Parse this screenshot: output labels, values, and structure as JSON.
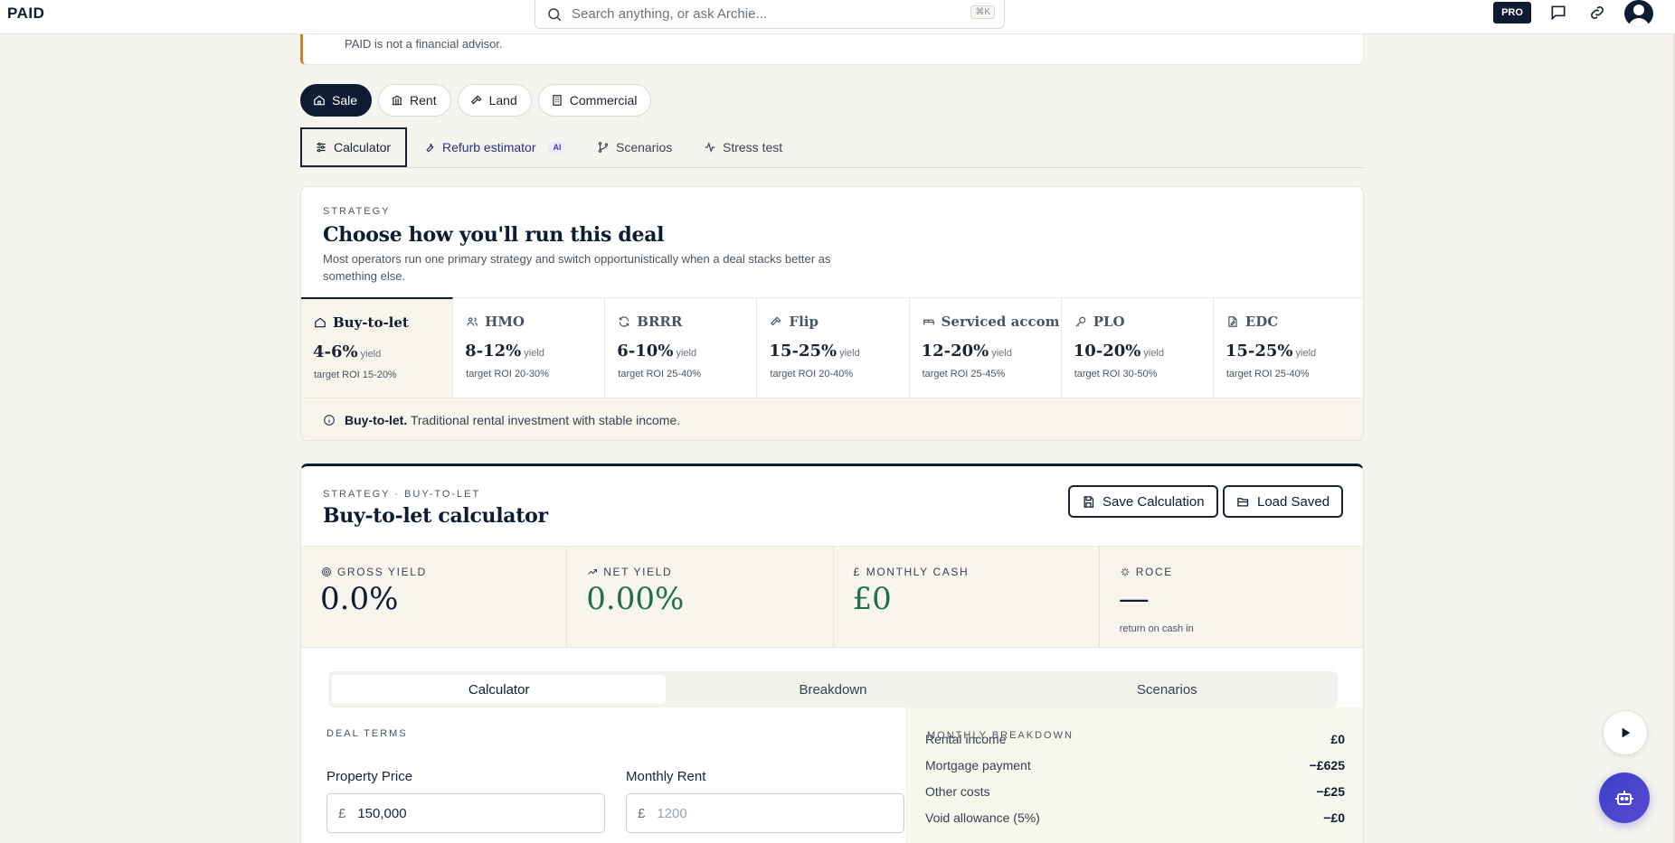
{
  "app": {
    "logo": "PAID"
  },
  "search": {
    "placeholder": "Search anything, or ask Archie...",
    "shortcut": "⌘K"
  },
  "header": {
    "pro_badge": "PRO"
  },
  "disclaimer": {
    "text": "PAID is not a financial advisor."
  },
  "property_types": [
    {
      "label": "Sale",
      "icon": "house-icon",
      "active": true
    },
    {
      "label": "Rent",
      "icon": "building-icon",
      "active": false
    },
    {
      "label": "Land",
      "icon": "hammer-icon",
      "active": false
    },
    {
      "label": "Commercial",
      "icon": "office-icon",
      "active": false
    }
  ],
  "subtabs": [
    {
      "label": "Calculator",
      "icon": "sliders-icon",
      "active": true
    },
    {
      "label": "Refurb estimator",
      "icon": "wrench-icon",
      "badge": "AI",
      "active": false
    },
    {
      "label": "Scenarios",
      "icon": "git-branch-icon",
      "active": false
    },
    {
      "label": "Stress test",
      "icon": "activity-icon",
      "active": false
    }
  ],
  "strategy": {
    "eyebrow": "STRATEGY",
    "title": "Choose how you'll run this deal",
    "description": "Most operators run one primary strategy and switch opportunistically when a deal stacks better as something else.",
    "options": [
      {
        "name": "Buy-to-let",
        "icon": "house-icon",
        "yield": "4-6%",
        "yield_unit": "yield",
        "roi": "target ROI 15-20%",
        "active": true
      },
      {
        "name": "HMO",
        "icon": "users-icon",
        "yield": "8-12%",
        "yield_unit": "yield",
        "roi": "target ROI 20-30%",
        "active": false
      },
      {
        "name": "BRRR",
        "icon": "refresh-icon",
        "yield": "6-10%",
        "yield_unit": "yield",
        "roi": "target ROI 25-40%",
        "active": false
      },
      {
        "name": "Flip",
        "icon": "hammer-icon",
        "yield": "15-25%",
        "yield_unit": "yield",
        "roi": "target ROI 20-40%",
        "active": false
      },
      {
        "name": "Serviced accom",
        "icon": "bed-icon",
        "yield": "12-20%",
        "yield_unit": "yield",
        "roi": "target ROI 25-45%",
        "active": false
      },
      {
        "name": "PLO",
        "icon": "key-icon",
        "yield": "10-20%",
        "yield_unit": "yield",
        "roi": "target ROI 30-50%",
        "active": false
      },
      {
        "name": "EDC",
        "icon": "document-edit-icon",
        "yield": "15-25%",
        "yield_unit": "yield",
        "roi": "target ROI 25-40%",
        "active": false
      }
    ],
    "info_bold": "Buy-to-let.",
    "info_text": "Traditional rental investment with stable income."
  },
  "calculator": {
    "eyebrow": "STRATEGY · BUY-TO-LET",
    "title": "Buy-to-let calculator",
    "save_label": "Save Calculation",
    "load_label": "Load Saved",
    "kpis": [
      {
        "label": "GROSS YIELD",
        "icon": "target-icon",
        "value": "0.0%",
        "tone": "dark"
      },
      {
        "label": "NET YIELD",
        "icon": "trending-up-icon",
        "value": "0.00%",
        "tone": "green"
      },
      {
        "label": "MONTHLY CASH",
        "icon": "pound-icon",
        "value": "£0",
        "tone": "green"
      },
      {
        "label": "ROCE",
        "icon": "sparkle-icon",
        "value": "—",
        "sub": "return on cash in",
        "tone": "dark"
      }
    ],
    "tabs": [
      {
        "label": "Calculator",
        "active": true
      },
      {
        "label": "Breakdown",
        "active": false
      },
      {
        "label": "Scenarios",
        "active": false
      }
    ],
    "deal_terms_label": "DEAL TERMS",
    "fields": [
      {
        "label": "Property Price",
        "currency": "£",
        "value": "150,000",
        "placeholder": ""
      },
      {
        "label": "Monthly Rent",
        "currency": "£",
        "value": "",
        "placeholder": "1200"
      }
    ],
    "monthly": {
      "eyebrow": "MONTHLY BREAKDOWN",
      "rows": [
        {
          "label": "Rental income",
          "value": "£0"
        },
        {
          "label": "Mortgage payment",
          "value": "−£625"
        },
        {
          "label": "Other costs",
          "value": "−£25"
        },
        {
          "label": "Void allowance (5%)",
          "value": "−£0"
        }
      ]
    }
  },
  "colors": {
    "navy": "#0e1b33",
    "accent_green": "#1f6e4e",
    "accent_orange": "#c9822a",
    "ai_purple": "#4338ca",
    "background": "#f5f4ee"
  }
}
